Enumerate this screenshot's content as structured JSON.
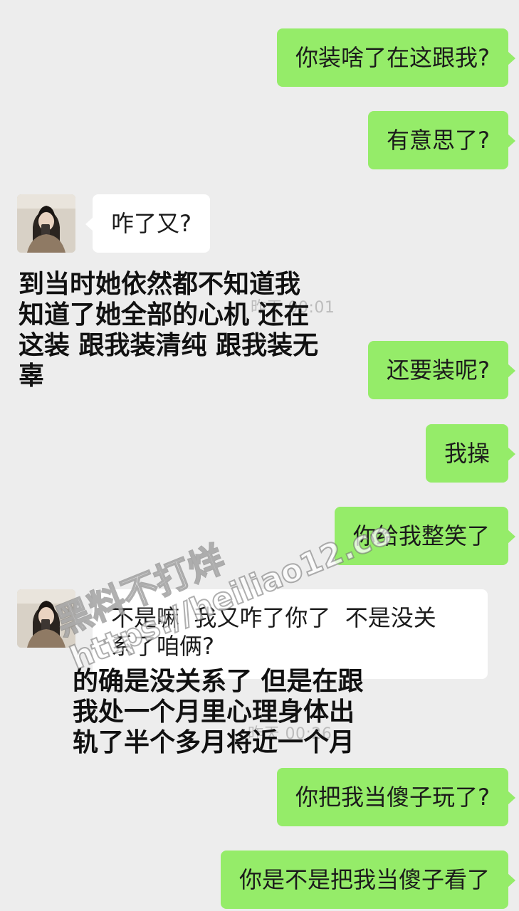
{
  "messages": [
    {
      "side": "out",
      "text": "你装啥了在这跟我?"
    },
    {
      "side": "out",
      "text": "有意思了?"
    },
    {
      "side": "in",
      "text": "咋了又?"
    },
    {
      "side": "out",
      "text": "还要装呢?"
    },
    {
      "side": "out",
      "text": "我操"
    },
    {
      "side": "out",
      "text": "你给我整笑了"
    },
    {
      "side": "in",
      "lines": [
        "不是嘛  我又咋了你了  不是没关",
        "系了咱俩?"
      ]
    },
    {
      "side": "out",
      "text": "你把我当傻子玩了?"
    },
    {
      "side": "out",
      "text": "你是不是把我当傻子看了"
    }
  ],
  "timestamps": [
    "昨天 00:01",
    "昨天 00:26"
  ],
  "captions": [
    {
      "lines": [
        "到当时她依然都不知道我",
        "知道了她全部的心机 还在",
        "这装 跟我装清纯 跟我装无",
        "辜"
      ]
    },
    {
      "lines": [
        "的确是没关系了 但是在跟",
        "我处一个月里心理身体出",
        "轨了半个多月将近一个月"
      ]
    }
  ],
  "watermark": {
    "line1": "黑料不打烊",
    "line2": "https://heiliao12.co"
  },
  "colors": {
    "background": "#ededed",
    "outgoing_bubble": "#95ec69",
    "incoming_bubble": "#ffffff"
  }
}
